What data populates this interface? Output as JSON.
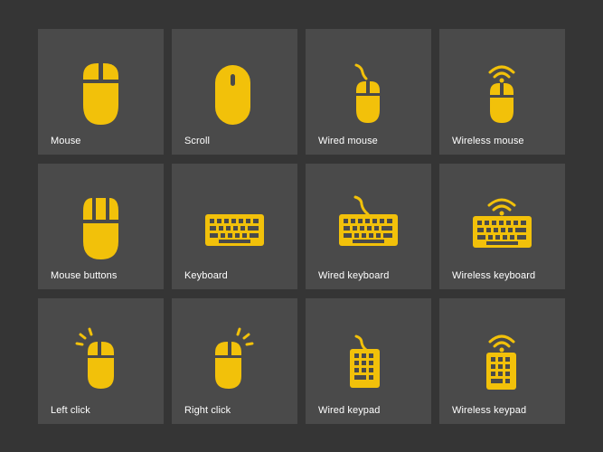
{
  "accent_color": "#f2c10a",
  "tile_color": "#4a4a4a",
  "background_color": "#353535",
  "tiles": [
    {
      "label": "Mouse",
      "icon": "mouse-icon"
    },
    {
      "label": "Scroll",
      "icon": "mouse-scroll-icon"
    },
    {
      "label": "Wired mouse",
      "icon": "wired-mouse-icon"
    },
    {
      "label": "Wireless mouse",
      "icon": "wireless-mouse-icon"
    },
    {
      "label": "Mouse buttons",
      "icon": "mouse-buttons-icon"
    },
    {
      "label": "Keyboard",
      "icon": "keyboard-icon"
    },
    {
      "label": "Wired keyboard",
      "icon": "wired-keyboard-icon"
    },
    {
      "label": "Wireless keyboard",
      "icon": "wireless-keyboard-icon"
    },
    {
      "label": "Left click",
      "icon": "left-click-icon"
    },
    {
      "label": "Right click",
      "icon": "right-click-icon"
    },
    {
      "label": "Wired keypad",
      "icon": "wired-keypad-icon"
    },
    {
      "label": "Wireless keypad",
      "icon": "wireless-keypad-icon"
    }
  ]
}
